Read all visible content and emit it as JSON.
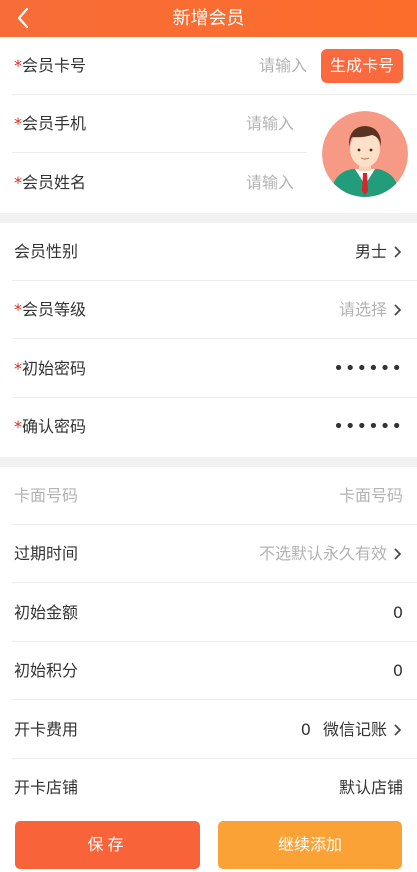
{
  "header": {
    "title": "新增会员",
    "back_icon": "chevron-left-icon"
  },
  "colors": {
    "header": "#f86c38",
    "required": "#e0281e",
    "save": "#f8633a",
    "continue": "#fba237"
  },
  "section1": {
    "card_no": {
      "label": "会员卡号",
      "placeholder": "请输入",
      "button": "生成卡号"
    },
    "phone": {
      "label": "会员手机",
      "placeholder": "请输入"
    },
    "name": {
      "label": "会员姓名",
      "placeholder": "请输入"
    }
  },
  "section2": {
    "gender": {
      "label": "会员性别",
      "value": "男士"
    },
    "level": {
      "label": "会员等级",
      "value": "请选择"
    },
    "init_pwd": {
      "label": "初始密码",
      "value": "••••••"
    },
    "confirm_pwd": {
      "label": "确认密码",
      "value": "••••••"
    }
  },
  "section3": {
    "face_no": {
      "label": "卡面号码",
      "placeholder": "卡面号码"
    },
    "expire": {
      "label": "过期时间",
      "value": "不选默认永久有效"
    },
    "init_amount": {
      "label": "初始金额",
      "value": "0"
    },
    "init_points": {
      "label": "初始积分",
      "value": "0"
    },
    "card_fee": {
      "label": "开卡费用",
      "amount": "0",
      "method": "微信记账"
    },
    "shop": {
      "label": "开卡店铺",
      "value": "默认店铺"
    }
  },
  "footer": {
    "save": "保存",
    "continue": "继续添加"
  }
}
